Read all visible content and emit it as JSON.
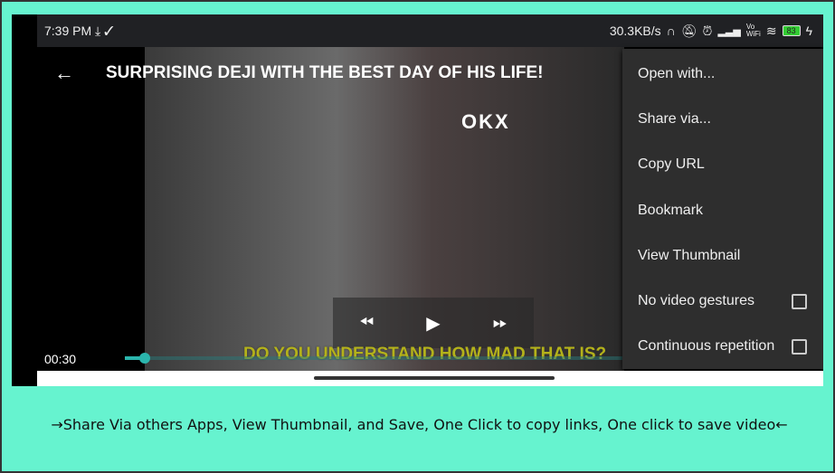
{
  "status": {
    "time": "7:39 PM",
    "left_icons": [
      "download-icon",
      "check-icon"
    ],
    "speed": "30.3KB/s",
    "right_icons": [
      "headset-icon",
      "mute-icon",
      "alarm-icon",
      "signal-icon",
      "vowifi-icon",
      "wifi-icon",
      "battery-icon",
      "charging-icon"
    ],
    "vowifi": "Vo WiFi",
    "battery": "83"
  },
  "player": {
    "title": "SURPRISING DEJI WITH THE BEST DAY OF HIS LIFE!",
    "time": "00:30",
    "progress_percent": 4,
    "subtitle": "DO YOU UNDERSTAND HOW MAD THAT IS?",
    "watermark": "OKX"
  },
  "menu": {
    "items": [
      {
        "label": "Open with..."
      },
      {
        "label": "Share via..."
      },
      {
        "label": "Copy URL"
      },
      {
        "label": "Bookmark"
      },
      {
        "label": "View Thumbnail"
      },
      {
        "label": "No video gestures",
        "checked": false
      },
      {
        "label": "Continuous repetition",
        "checked": false
      }
    ]
  },
  "caption": "→Share Via others Apps, View Thumbnail, and Save, One Click to copy links, One click to save video←",
  "colors": {
    "background": "#66f3cf",
    "accent": "#2bb5ad",
    "menu": "#2e2e2e"
  }
}
